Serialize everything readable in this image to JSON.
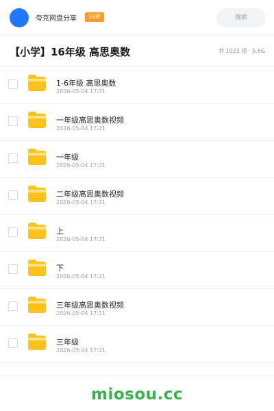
{
  "header": {
    "app_name": "夸克网盘分享",
    "badge": "SVIP",
    "search_placeholder": "搜索"
  },
  "share": {
    "title": "【小学】16年级 高思奥数",
    "summary": "共 1023 项 · 5.6G"
  },
  "files": [
    {
      "name": "1-6年级 高思奥数",
      "date": "2026-05-04 17:21",
      "icon": "folder-icon"
    },
    {
      "name": "一年级高思奥数视频",
      "date": "2026-05-04 17:21",
      "icon": "folder-icon"
    },
    {
      "name": "一年级",
      "date": "2026-05-04 17:21",
      "icon": "folder-icon"
    },
    {
      "name": "二年级高思奥数视频",
      "date": "2026-05-04 17:21",
      "icon": "folder-icon"
    },
    {
      "name": "上",
      "date": "2026-05-04 17:21",
      "icon": "folder-icon"
    },
    {
      "name": "下",
      "date": "2026-05-04 17:21",
      "icon": "folder-icon"
    },
    {
      "name": "三年级高思奥数视频",
      "date": "2026-05-04 17:21",
      "icon": "folder-icon"
    },
    {
      "name": "三年级",
      "date": "2026-05-04 17:21",
      "icon": "folder-icon"
    }
  ],
  "footer": {
    "watermark": "miosou.cc"
  },
  "colors": {
    "avatar": "#1f78ff",
    "badge": "#ff9a2b",
    "folder": "#ffc21c",
    "watermark": "#36b24c"
  }
}
